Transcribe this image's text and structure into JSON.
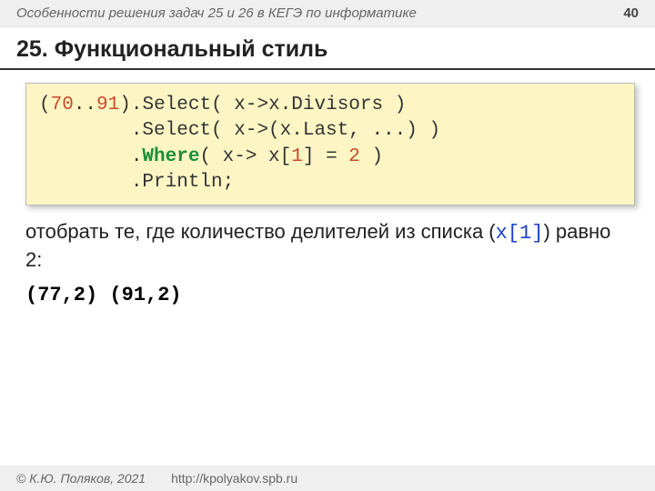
{
  "header": {
    "subject": "Особенности решения задач 25 и 26 в КЕГЭ по информатике",
    "page": "40"
  },
  "title": "25. Функциональный стиль",
  "code": {
    "line1_a": "(",
    "line1_num1": "70",
    "line1_b": "..",
    "line1_num2": "91",
    "line1_c": ").Select( x->x.Divisors )",
    "line2": "        .Select( x->(x.Last, ...) )",
    "line3_a": "        .",
    "line3_kw": "Where",
    "line3_b": "( x-> x[",
    "line3_num": "1",
    "line3_c": "] = ",
    "line3_num2": "2",
    "line3_d": " )",
    "line4": "        .Println;"
  },
  "desc": {
    "part1": "отобрать те, где количество делителей из списка (",
    "mono": "x[1]",
    "part2": ") равно 2:"
  },
  "output": "(77,2) (91,2)",
  "footer": {
    "copyright": "© К.Ю. Поляков, 2021",
    "url": "http://kpolyakov.spb.ru"
  }
}
